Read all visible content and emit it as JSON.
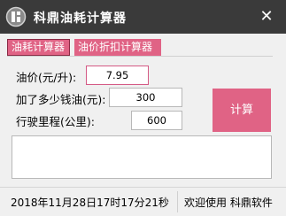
{
  "window": {
    "title": "科鼎油耗计算器",
    "close_glyph": "✕"
  },
  "tabs": [
    {
      "label": "油耗计算器",
      "active": true
    },
    {
      "label": "油价折扣计算器",
      "active": false
    }
  ],
  "form": {
    "oil_price_label": "油价(元/升):",
    "oil_price_value": "7.95",
    "money_label": "加了多少钱油(元):",
    "money_value": "300",
    "distance_label": "行驶里程(公里):",
    "distance_value": "600"
  },
  "calculate_button": "计算",
  "result_text": "",
  "status": {
    "datetime": "2018年11月28日17时17分21秒",
    "welcome": "欢迎使用 科鼎软件"
  },
  "colors": {
    "titlebar": "#3a3a3a",
    "accent": "#e06385",
    "background": "#f0f0f0"
  },
  "icons": {
    "app": "app-logo-icon",
    "close": "close-icon"
  }
}
